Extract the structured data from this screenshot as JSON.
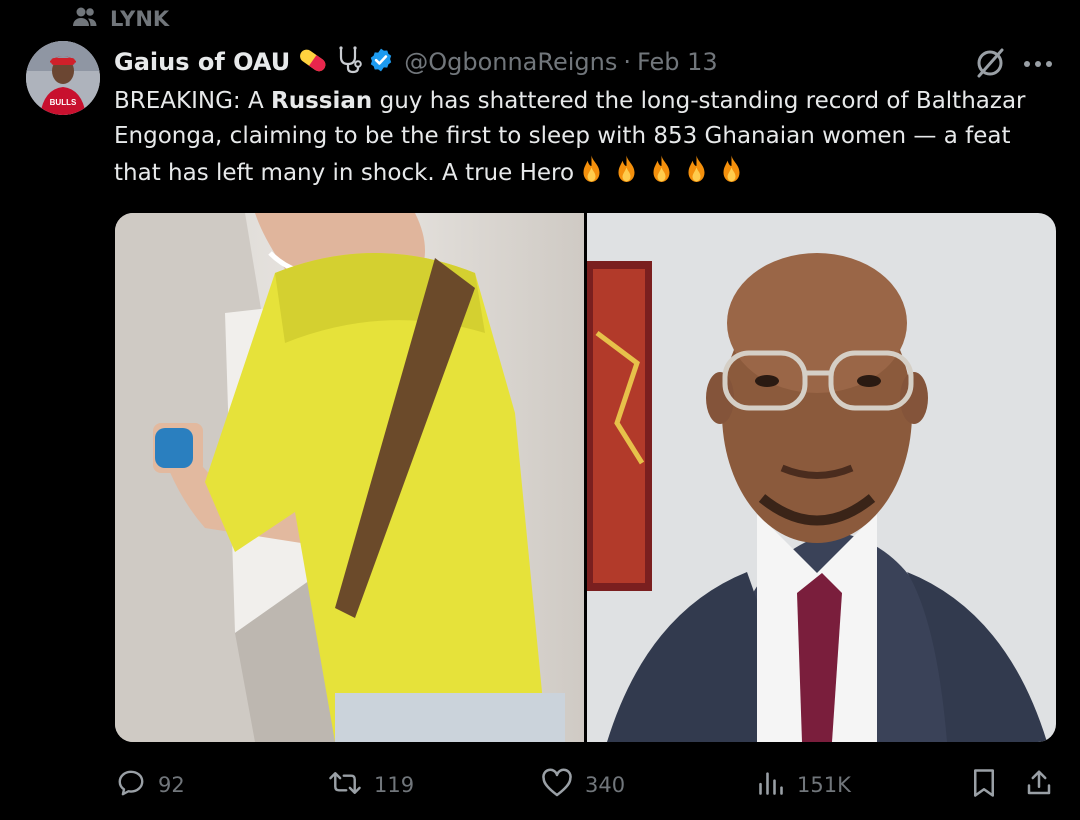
{
  "community": {
    "icon": "people-icon",
    "label": "LYNK"
  },
  "author": {
    "display_name": "Gaius of OAU",
    "name_emojis": [
      "pill-icon",
      "stethoscope-icon"
    ],
    "verified": true,
    "handle": "@OgbonnaReigns",
    "separator": "·",
    "date": "Feb 13"
  },
  "tweet": {
    "text_prefix": "BREAKING: A ",
    "text_bold": "Russian",
    "text_suffix": " guy has shattered the long-standing record of Balthazar Engonga, claiming to be the first to sleep with 853 Ghanaian women — a feat that has left many in shock. A true Hero",
    "trailing_emoji": "fire-icon",
    "trailing_emoji_count": 5
  },
  "media": [
    {
      "alt_icon": "man-in-yellow-shirt-photo"
    },
    {
      "alt_icon": "bald-man-in-suit-photo"
    }
  ],
  "actions": {
    "replies": "92",
    "reposts": "119",
    "likes": "340",
    "views": "151K"
  },
  "colors": {
    "background": "#000000",
    "text": "#e7e9ea",
    "muted": "#71767b",
    "verified": "#1d9bf0"
  }
}
